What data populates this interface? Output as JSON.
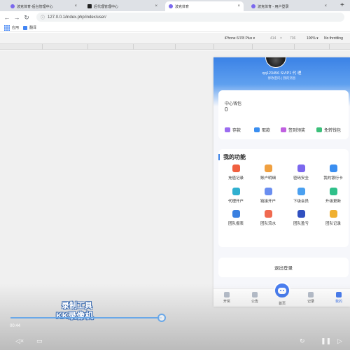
{
  "browser": {
    "tabs": [
      {
        "label": "波克体育-后台管理中心",
        "favicon_color": "#7b68ee"
      },
      {
        "label": "后代理管理中心",
        "favicon_color": "#222222"
      },
      {
        "label": "波克体育",
        "favicon_color": "#7b68ee"
      },
      {
        "label": "波克体育 - 用户登录",
        "favicon_color": "#7b68ee"
      }
    ],
    "url": "127.0.0.1/index.php/index/user/",
    "bookmarks": [
      "应用",
      "翻译"
    ]
  },
  "devtools": {
    "device": "iPhone 6/7/8 Plus ▾",
    "width": "414",
    "height": "736",
    "zoom": "100% ▾",
    "throttling": "No throttling"
  },
  "profile": {
    "username": "qq123456 SVIP1 代 理",
    "links": "修改密码 | 我的消息"
  },
  "wallet": {
    "title": "中心钱包",
    "balance": "0",
    "actions": [
      {
        "label": "存款",
        "color": "#9b6cf0"
      },
      {
        "label": "取款",
        "color": "#3a8ef0"
      },
      {
        "label": "签到领奖",
        "color": "#c060e0"
      },
      {
        "label": "免转钱包",
        "color": "#3cc07a"
      }
    ]
  },
  "functions": {
    "title": "我的功能",
    "items": [
      {
        "label": "充值记录",
        "color": "#f06040"
      },
      {
        "label": "账户明细",
        "color": "#f0a040"
      },
      {
        "label": "密码安全",
        "color": "#7b68ee"
      },
      {
        "label": "我的银行卡",
        "color": "#3a8ef0"
      },
      {
        "label": "代理开户",
        "color": "#30b0d0"
      },
      {
        "label": "链接开户",
        "color": "#6a8ef0"
      },
      {
        "label": "下级会员",
        "color": "#4aa0f0"
      },
      {
        "label": "升级更新",
        "color": "#2fc08a"
      },
      {
        "label": "团队报表",
        "color": "#3a80e0"
      },
      {
        "label": "团队流水",
        "color": "#f06a50"
      },
      {
        "label": "团队盈亏",
        "color": "#3050c0"
      },
      {
        "label": "团队记录",
        "color": "#f0b030"
      }
    ]
  },
  "logout_label": "退出登录",
  "nav": {
    "items": [
      {
        "label": "开奖"
      },
      {
        "label": "公告"
      },
      {
        "label": "首页"
      },
      {
        "label": "记录"
      },
      {
        "label": "我的"
      }
    ],
    "active_color": "#4a7ef0"
  },
  "video": {
    "watermark_line1": "录制工具",
    "watermark_line2": "KK录像机",
    "time": "00:44",
    "progress": 0.46
  }
}
